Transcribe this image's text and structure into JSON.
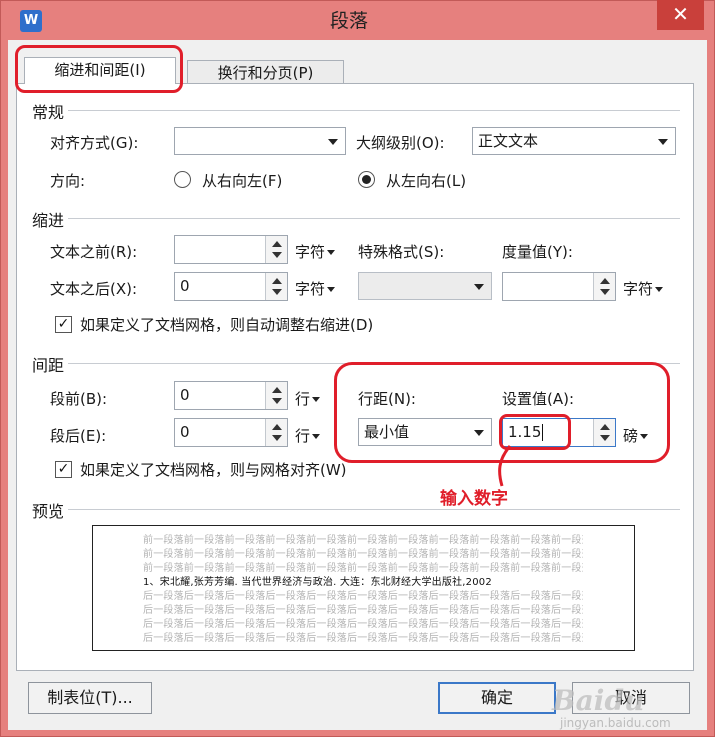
{
  "window": {
    "title": "段落",
    "app_icon": "W",
    "close_glyph": "✕"
  },
  "tabs": [
    {
      "label": "缩进和间距(I)"
    },
    {
      "label": "换行和分页(P)"
    }
  ],
  "general": {
    "group": "常规",
    "align_label": "对齐方式(G):",
    "align_value": "",
    "outline_label": "大纲级别(O):",
    "outline_value": "正文文本",
    "direction_label": "方向:",
    "rtl_label": "从右向左(F)",
    "ltr_label": "从左向右(L)"
  },
  "indent": {
    "group": "缩进",
    "before_label": "文本之前(R):",
    "before_value": "",
    "after_label": "文本之后(X):",
    "after_value": "0",
    "unit": "字符",
    "special_label": "特殊格式(S):",
    "special_value": "",
    "measure_label": "度量值(Y):",
    "measure_value": "",
    "auto_label": "如果定义了文档网格，则自动调整右缩进(D)"
  },
  "spacing": {
    "group": "间距",
    "before_label": "段前(B):",
    "before_value": "0",
    "after_label": "段后(E):",
    "after_value": "0",
    "unit": "行",
    "line_label": "行距(N):",
    "line_value": "最小值",
    "setting_label": "设置值(A):",
    "setting_value": "1.15",
    "setting_unit": "磅",
    "grid_label": "如果定义了文档网格，则与网格对齐(W)"
  },
  "annotation": {
    "text": "输入数字",
    "color": "#e01e2a"
  },
  "preview": {
    "group": "预览",
    "before_line": "前一段落前一段落前一段落前一段落前一段落前一段落前一段落前一段落前一段落前一段落前一段落前一段落",
    "main_line": "1、宋北耀,张芳芳编. 当代世界经济与政治. 大连：东北财经大学出版社,2002",
    "after_line": "后一段落后一段落后一段落后一段落后一段落后一段落后一段落后一段落后一段落后一段落后一段落后一段落"
  },
  "buttons": {
    "tabs": "制表位(T)...",
    "ok": "确定",
    "cancel": "取消"
  },
  "watermark": {
    "brand": "Baidu",
    "sub": "jingyan.baidu.com"
  },
  "colors": {
    "frame": "#e6807e",
    "highlight": "#e01e2a",
    "ok_border": "#3b78c8"
  }
}
